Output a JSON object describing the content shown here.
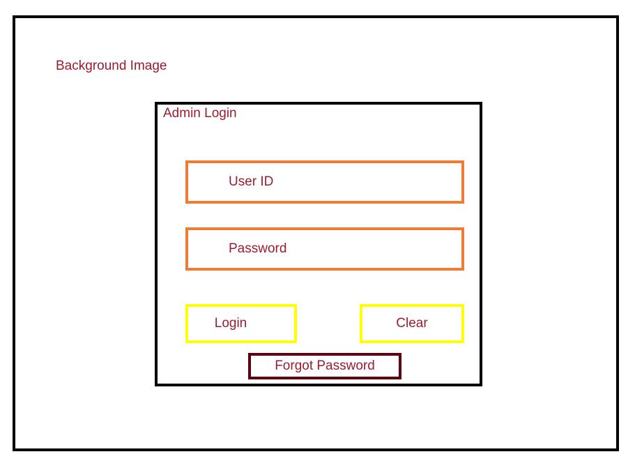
{
  "page": {
    "background_label": "Background Image"
  },
  "panel": {
    "title": "Admin Login",
    "user_field_label": "User ID",
    "password_field_label": "Password",
    "login_button_label": "Login",
    "clear_button_label": "Clear",
    "forgot_password_label": "Forgot Password"
  },
  "colors": {
    "text": "#9b1c2f",
    "frame": "#000000",
    "field_border": "#ed7d31",
    "button_border": "#ffff00",
    "forgot_border": "#5a0012"
  }
}
